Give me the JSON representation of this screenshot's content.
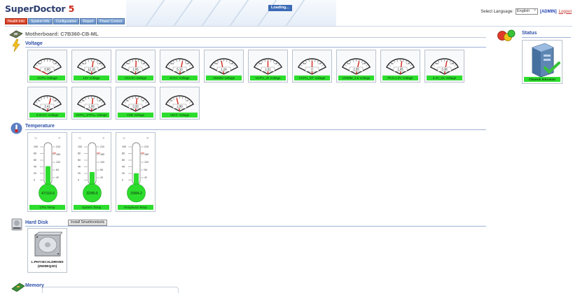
{
  "app": {
    "brand": "SuperDoctor",
    "brand_version": "5"
  },
  "tabs": [
    {
      "label": "Health Info",
      "active": true
    },
    {
      "label": "System Info",
      "active": false
    },
    {
      "label": "Configuration",
      "active": false
    },
    {
      "label": "Report",
      "active": false
    },
    {
      "label": "Power Control",
      "active": false
    }
  ],
  "loading_text": "Loading...",
  "language": {
    "label": "Select Language:",
    "value": "English"
  },
  "user": {
    "admin_label": "[ADMIN]",
    "logout_label": "Logout"
  },
  "motherboard": {
    "title": "Motherboard: C7B360-CB-ML"
  },
  "sections": {
    "voltage": "Voltage",
    "temperature": "Temperature",
    "hard_disk": "Hard Disk",
    "memory": "Memory",
    "status": "Status"
  },
  "voltages": [
    {
      "label": "VCPU Voltage",
      "value": "0.00",
      "min": "0.00",
      "max": "1.67",
      "needle": 0.0
    },
    {
      "label": "12V Voltage",
      "value": "12.16",
      "min": "10.27",
      "max": "13.63",
      "needle": 0.56
    },
    {
      "label": "VCCSA Voltage",
      "value": "1.06",
      "min": "0.85",
      "max": "1.25",
      "needle": 0.52
    },
    {
      "label": "5VCC Voltage",
      "value": "5.10",
      "min": "4.25",
      "max": "5.67",
      "needle": 0.6
    },
    {
      "label": "VDIMM Voltage",
      "value": "1.24",
      "min": "1.06",
      "max": "1.52",
      "needle": 0.42
    },
    {
      "label": "VCPU_IO Voltage",
      "value": "1.01",
      "min": "0.85",
      "max": "1.15",
      "needle": 0.5
    },
    {
      "label": "VCPU_GT Voltage",
      "value": "0",
      "min": "0.00",
      "max": "1.67",
      "needle": 0.5
    },
    {
      "label": "VDIMM_2.5 Voltage",
      "value": "2.55",
      "min": "2.23",
      "max": "2.75",
      "needle": 0.6
    },
    {
      "label": "PCH 1.0V Voltage",
      "value": "1.05",
      "min": "0.9",
      "max": "1.15",
      "needle": 0.55
    },
    {
      "label": "3.3V_DL Voltage",
      "value": "3.38",
      "min": "2.85",
      "max": "3.63",
      "needle": 0.58
    },
    {
      "label": "3.3VCC Voltage",
      "value": "3.41",
      "min": "2.9",
      "max": "3.60",
      "needle": 0.62
    },
    {
      "label": "VCPU_STPLL Voltage",
      "value": "1.09",
      "min": "0.9",
      "max": "1.25",
      "needle": 0.55
    },
    {
      "label": "VSB Voltage",
      "value": "3.33",
      "min": "2.9",
      "max": "3.6",
      "needle": 0.55
    },
    {
      "label": "VBAT Voltage",
      "value": "2.99",
      "min": "2.7",
      "max": "3.5",
      "needle": 0.4
    }
  ],
  "temperatures": [
    {
      "label": "CPU Temp",
      "reading": "47/116.6",
      "fill": 0.47,
      "c_ticks": [
        "100",
        "80",
        "60",
        "40",
        "20",
        "0"
      ],
      "f_ticks": [
        "210",
        "180",
        "120",
        "84",
        "42"
      ]
    },
    {
      "label": "System Temp",
      "reading": "32/89.6",
      "fill": 0.32,
      "c_ticks": [
        "100",
        "80",
        "60",
        "40",
        "20",
        "0"
      ],
      "f_ticks": [
        "210",
        "180",
        "120",
        "84",
        "42"
      ]
    },
    {
      "label": "Peripheral Temp",
      "reading": "29/84.2",
      "fill": 0.29,
      "c_ticks": [
        "100",
        "80",
        "60",
        "40",
        "20",
        "0"
      ],
      "f_ticks": [
        "210",
        "180",
        "120",
        "84",
        "42"
      ]
    }
  ],
  "hard_disk": {
    "install_button": "Install Smartmontools",
    "drive_label_1": "L:PHYSICALDRIVE0",
    "drive_label_2": "(Z500EQ3O)"
  },
  "status": {
    "chassis_label": "Chassis Intrusion"
  },
  "colors": {
    "ok_green": "#2ddd2d",
    "accent_blue": "#2d4fa8",
    "needle_red": "#d2261a"
  }
}
